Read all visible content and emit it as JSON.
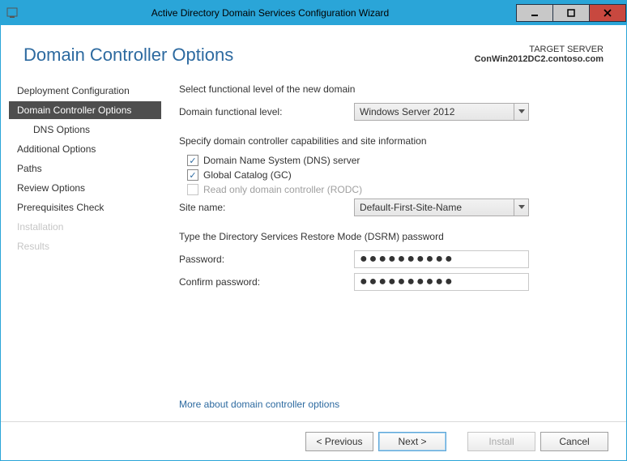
{
  "titlebar": {
    "title": "Active Directory Domain Services Configuration Wizard"
  },
  "page_title": "Domain Controller Options",
  "target": {
    "label": "TARGET SERVER",
    "server": "ConWin2012DC2.contoso.com"
  },
  "sidebar": {
    "items": [
      {
        "label": "Deployment Configuration"
      },
      {
        "label": "Domain Controller Options"
      },
      {
        "label": "DNS Options"
      },
      {
        "label": "Additional Options"
      },
      {
        "label": "Paths"
      },
      {
        "label": "Review Options"
      },
      {
        "label": "Prerequisites Check"
      },
      {
        "label": "Installation"
      },
      {
        "label": "Results"
      }
    ]
  },
  "main": {
    "functional_level_heading": "Select functional level of the new domain",
    "domain_functional_label": "Domain functional level:",
    "domain_functional_value": "Windows Server 2012",
    "capabilities_heading": "Specify domain controller capabilities and site information",
    "dns_label": "Domain Name System (DNS) server",
    "gc_label": "Global Catalog (GC)",
    "rodc_label": "Read only domain controller (RODC)",
    "site_label": "Site name:",
    "site_value": "Default-First-Site-Name",
    "dsrm_heading": "Type the Directory Services Restore Mode (DSRM) password",
    "password_label": "Password:",
    "confirm_label": "Confirm password:",
    "password_mask": "●●●●●●●●●●",
    "confirm_mask": "●●●●●●●●●●",
    "more_link": "More about domain controller options"
  },
  "footer": {
    "previous": "< Previous",
    "next": "Next >",
    "install": "Install",
    "cancel": "Cancel"
  }
}
